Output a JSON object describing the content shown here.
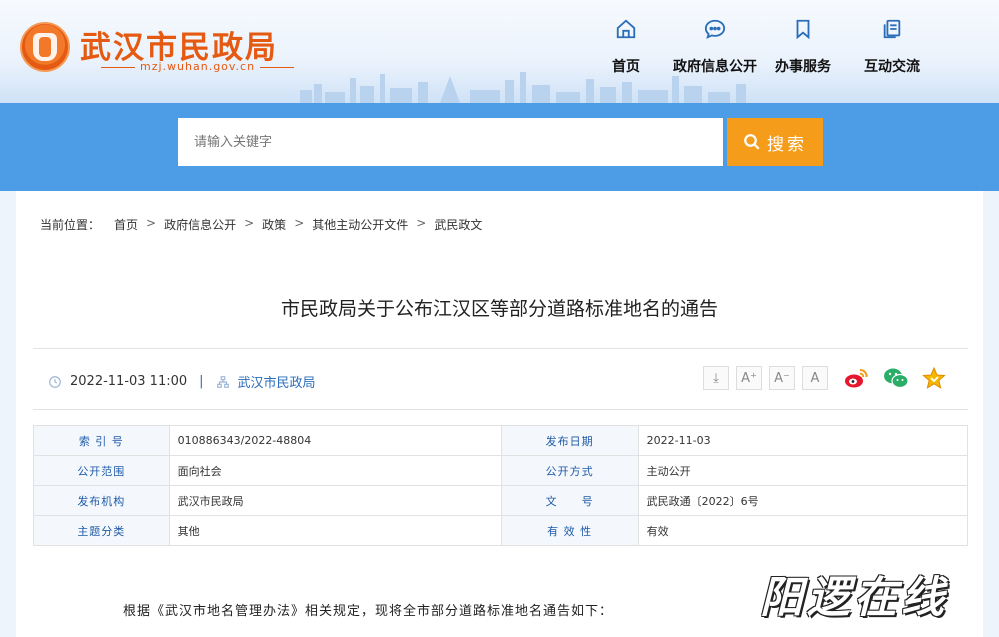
{
  "site": {
    "title": "武汉市民政局",
    "url": "mzj.wuhan.gov.cn",
    "brand_color": "#e55a12",
    "accent_color": "#4d9ce6"
  },
  "nav": [
    {
      "label": "首页",
      "icon": "home-icon"
    },
    {
      "label": "政府信息公开",
      "icon": "chat-bubble-icon"
    },
    {
      "label": "办事服务",
      "icon": "bookmark-icon"
    },
    {
      "label": "互动交流",
      "icon": "documents-icon"
    }
  ],
  "search": {
    "placeholder": "请输入关键字",
    "button_label": "搜索"
  },
  "breadcrumb": {
    "prefix": "当前位置：",
    "items": [
      "首页",
      "政府信息公开",
      "政策",
      "其他主动公开文件",
      "武民政文"
    ],
    "separator": ">"
  },
  "article": {
    "title": "市民政局关于公布江汉区等部分道路标准地名的通告",
    "datetime": "2022-11-03 11:00",
    "publisher": "武汉市民政局",
    "first_paragraph": "根据《武汉市地名管理办法》相关规定，现将全市部分道路标准地名通告如下："
  },
  "tools": {
    "download": "⤓",
    "font_large": "A⁺",
    "font_small": "A⁻",
    "font_reset": "A"
  },
  "info_table": {
    "rows": [
      [
        {
          "k": "索 引 号",
          "v": "010886343/2022-48804"
        },
        {
          "k": "发布日期",
          "v": "2022-11-03"
        }
      ],
      [
        {
          "k": "公开范围",
          "v": "面向社会"
        },
        {
          "k": "公开方式",
          "v": "主动公开"
        }
      ],
      [
        {
          "k": "发布机构",
          "v": "武汉市民政局"
        },
        {
          "k": "文　　号",
          "v": "武民政通〔2022〕6号"
        }
      ],
      [
        {
          "k": "主题分类",
          "v": "其他"
        },
        {
          "k": "有 效 性",
          "v": "有效"
        }
      ]
    ]
  },
  "watermark": "阳逻在线"
}
